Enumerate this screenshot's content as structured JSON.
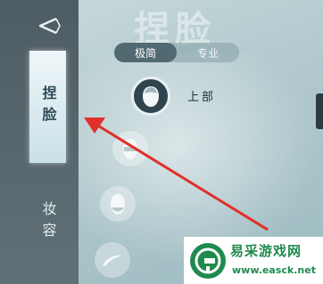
{
  "header": {
    "title": "捏脸"
  },
  "sidebar": {
    "tabs": [
      {
        "label": "捏脸",
        "active": true
      },
      {
        "label": "妆容",
        "active": false
      }
    ]
  },
  "mode_toggle": {
    "options": [
      "极简",
      "专业"
    ],
    "selected": "极简"
  },
  "face_parts": {
    "selected_label": "上部",
    "items": [
      "upper-face",
      "mid-face",
      "lower-face",
      "eyebrow"
    ]
  },
  "watermark": {
    "title": "易采游戏网",
    "url": "www.easck.net"
  },
  "colors": {
    "sidebar": "#55666c",
    "active_tab": "#e6f2f5",
    "arrow": "#e0302b",
    "watermark": "#1f8a4e"
  }
}
